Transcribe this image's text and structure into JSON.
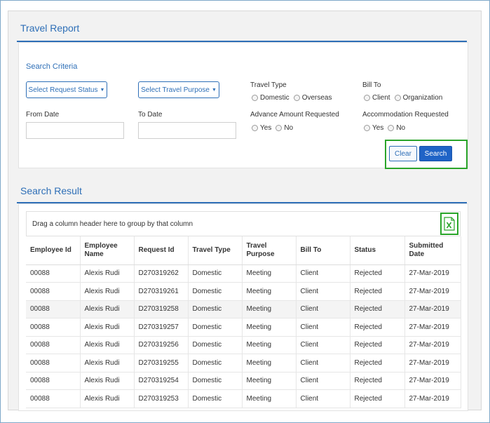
{
  "report": {
    "title": "Travel Report"
  },
  "search_criteria": {
    "title": "Search Criteria",
    "request_status_btn": "Select Request Status",
    "travel_purpose_btn": "Select Travel Purpose",
    "travel_type": {
      "label": "Travel Type",
      "options": [
        "Domestic",
        "Overseas"
      ]
    },
    "bill_to": {
      "label": "Bill To",
      "options": [
        "Client",
        "Organization"
      ]
    },
    "from_date": {
      "label": "From Date",
      "value": ""
    },
    "to_date": {
      "label": "To Date",
      "value": ""
    },
    "advance_amount": {
      "label": "Advance Amount Requested",
      "options": [
        "Yes",
        "No"
      ]
    },
    "accommodation": {
      "label": "Accommodation Requested",
      "options": [
        "Yes",
        "No"
      ]
    },
    "clear_label": "Clear",
    "search_label": "Search"
  },
  "search_result": {
    "title": "Search Result",
    "group_hint": "Drag a column header here to group by that column",
    "excel_icon": "excel-export-icon",
    "columns": [
      "Employee Id",
      "Employee Name",
      "Request Id",
      "Travel Type",
      "Travel Purpose",
      "Bill To",
      "Status",
      "Submitted Date"
    ],
    "rows": [
      [
        "00088",
        "Alexis Rudi",
        "D270319262",
        "Domestic",
        "Meeting",
        "Client",
        "Rejected",
        "27-Mar-2019"
      ],
      [
        "00088",
        "Alexis Rudi",
        "D270319261",
        "Domestic",
        "Meeting",
        "Client",
        "Rejected",
        "27-Mar-2019"
      ],
      [
        "00088",
        "Alexis Rudi",
        "D270319258",
        "Domestic",
        "Meeting",
        "Client",
        "Rejected",
        "27-Mar-2019"
      ],
      [
        "00088",
        "Alexis Rudi",
        "D270319257",
        "Domestic",
        "Meeting",
        "Client",
        "Rejected",
        "27-Mar-2019"
      ],
      [
        "00088",
        "Alexis Rudi",
        "D270319256",
        "Domestic",
        "Meeting",
        "Client",
        "Rejected",
        "27-Mar-2019"
      ],
      [
        "00088",
        "Alexis Rudi",
        "D270319255",
        "Domestic",
        "Meeting",
        "Client",
        "Rejected",
        "27-Mar-2019"
      ],
      [
        "00088",
        "Alexis Rudi",
        "D270319254",
        "Domestic",
        "Meeting",
        "Client",
        "Rejected",
        "27-Mar-2019"
      ],
      [
        "00088",
        "Alexis Rudi",
        "D270319253",
        "Domestic",
        "Meeting",
        "Client",
        "Rejected",
        "27-Mar-2019"
      ]
    ]
  },
  "colors": {
    "accent": "#2e6fb7",
    "primary_button": "#1f63c6",
    "highlight_box": "#2aa52a"
  }
}
